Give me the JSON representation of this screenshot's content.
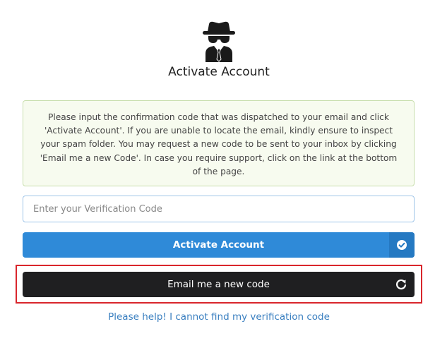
{
  "header": {
    "logo_icon": "incognito-spy-icon",
    "title": "Activate Account"
  },
  "notice": {
    "text": "Please input the confirmation code that was dispatched to your email and click 'Activate Account'. If you are unable to locate the email, kindly ensure to inspect your spam folder. You may request a new code to be sent to your inbox by clicking 'Email me a new Code'. In case you require support, click on the link at the bottom of the page."
  },
  "form": {
    "code_value": "",
    "code_placeholder": "Enter your Verification Code",
    "activate_label": "Activate Account",
    "activate_icon": "check-circle-icon",
    "email_label": "Email me a new code",
    "email_icon": "refresh-icon"
  },
  "footer": {
    "help_link": "Please help! I cannot find my verification code"
  },
  "colors": {
    "primary": "#2f8ad8",
    "dark_button": "#1f1f21",
    "highlight_border": "#d9262c",
    "notice_background": "#f7fbef",
    "notice_border": "#c9dfae",
    "link": "#3a7fc0"
  }
}
